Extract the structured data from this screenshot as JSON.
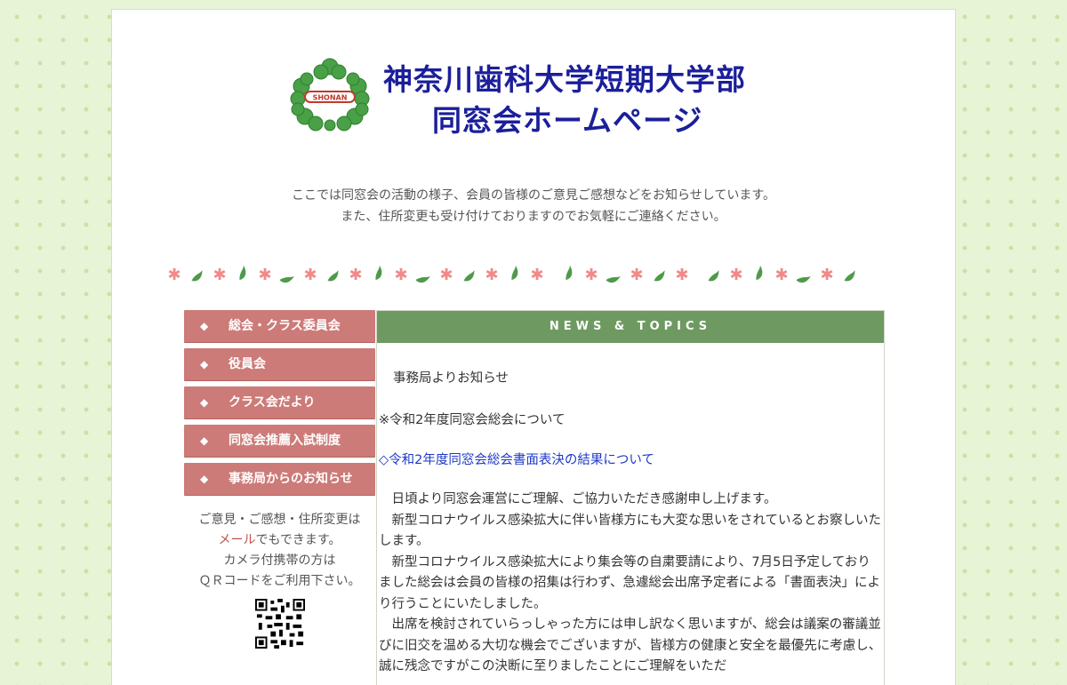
{
  "header": {
    "title_line1": "神奈川歯科大学短期大学部",
    "title_line2": "同窓会ホームページ",
    "logo_text": "SHONAN",
    "title_color": "#1b1f9a"
  },
  "intro": {
    "line1": "ここでは同窓会の活動の様子、会員の皆様のご意見ご感想などをお知らせしています。",
    "line2": "また、住所変更も受け付けておりますのでお気軽にご連絡ください。"
  },
  "sidebar": {
    "bullet": "◆",
    "items": [
      {
        "label": "総会・クラス委員会"
      },
      {
        "label": "役員会"
      },
      {
        "label": "クラス会だより"
      },
      {
        "label": "同窓会推薦入試制度"
      },
      {
        "label": "事務局からのお知らせ"
      }
    ],
    "note_line1": "ご意見・ご感想・住所変更は",
    "note_mail": "メール",
    "note_line2_rest": "でもできます。",
    "note_line3": "カメラ付携帯の方は",
    "note_line4": "ＱＲコードをご利用下さい。",
    "menu_color": "#cc7b78"
  },
  "news": {
    "header": "NEWS & TOPICS",
    "office_title": "事務局よりお知らせ",
    "notice": "※令和2年度同窓会総会について",
    "link": "◇令和2年度同窓会総会書面表決の結果について",
    "para1": "日頃より同窓会運営にご理解、ご協力いただき感謝申し上げます。",
    "para2": "新型コロナウイルス感染拡大に伴い皆様方にも大変な思いをされているとお察しいたします。",
    "para3": "新型コロナウイルス感染拡大により集会等の自粛要請により、7月5日予定しておりました総会は会員の皆様の招集は行わず、急遽総会出席予定者による「書面表決」により行うことにいたしました。",
    "para4": "出席を検討されていらっしゃった方には申し訳なく思いますが、総会は議案の審議並びに旧交を温める大切な機会でございますが、皆様方の健康と安全を最優先に考慮し、誠に残念ですがこの決断に至りましたことにご理解をいただ",
    "header_color": "#6e9960",
    "link_color": "#1e39c8"
  }
}
